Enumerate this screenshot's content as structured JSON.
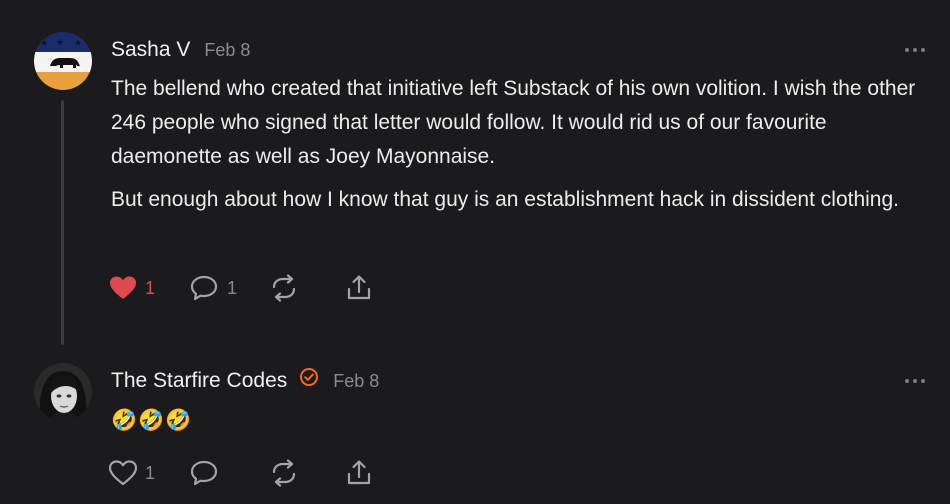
{
  "comments": [
    {
      "author": "Sasha V",
      "date": "Feb 8",
      "paragraphs": [
        "The bellend who created that initiative left Substack of his own volition. I wish the other 246 people who signed that letter would follow. It would rid us of our favourite daemonette as well as Joey Mayonnaise.",
        "But enough about how I know that guy is an establishment hack in dissident clothing."
      ],
      "likes": "1",
      "replies": "1",
      "liked": true
    },
    {
      "author": "The Starfire Codes",
      "date": "Feb 8",
      "verified": true,
      "emojis": [
        "🤣",
        "🤣",
        "🤣"
      ],
      "likes": "1",
      "replies": "",
      "liked": false
    }
  ],
  "icons": {
    "like": "heart-icon",
    "reply": "speech-bubble-icon",
    "restack": "restack-arrows-icon",
    "share": "share-upload-icon",
    "more": "more-horizontal-icon",
    "verified": "verified-check-badge-icon"
  },
  "colors": {
    "background": "#1b1b1d",
    "liked": "#e0494f",
    "muted": "#8b8b8f",
    "verified": "#ff6719"
  }
}
